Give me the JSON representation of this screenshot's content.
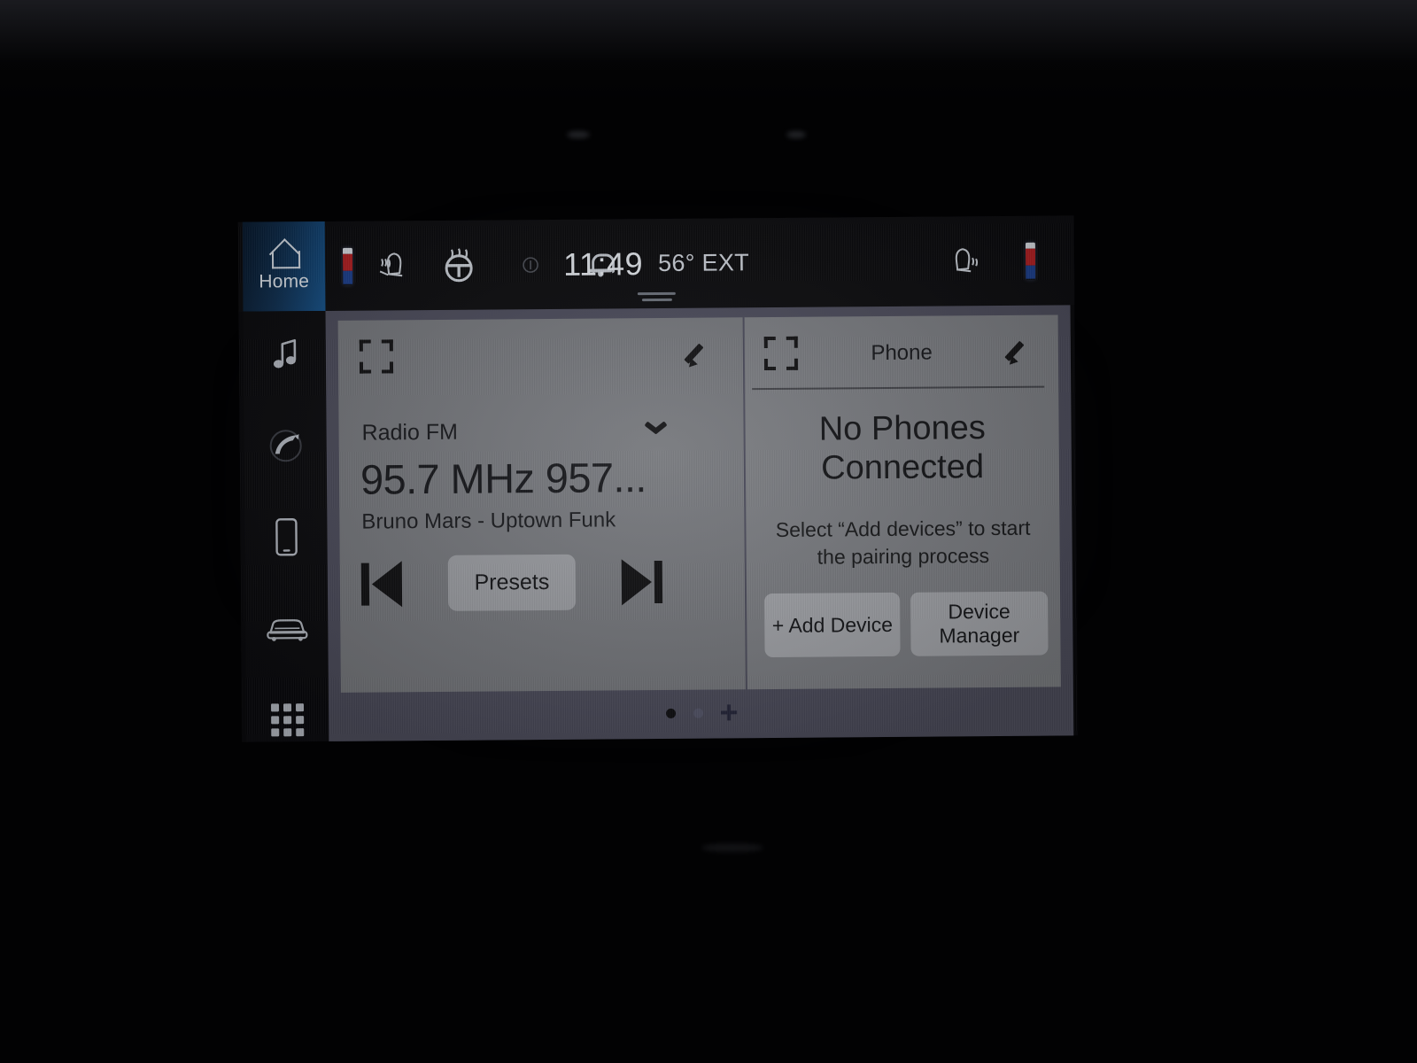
{
  "statusbar": {
    "home_label": "Home",
    "clock": "11:49",
    "exterior_temp": "56° EXT",
    "icons": {
      "home": "home-icon",
      "driver_temp_bar": "driver-temperature-bar",
      "driver_seat_heater": "driver-seat-heater-icon",
      "steering_wheel_heater": "steering-wheel-heater-icon",
      "recirculation": "recirculation-icon",
      "notification_bell": "bell-icon",
      "passenger_seat_heater": "passenger-seat-heater-icon",
      "passenger_temp_bar": "passenger-temperature-bar"
    }
  },
  "sidebar": {
    "items": [
      {
        "name": "audio",
        "icon": "music-note-icon"
      },
      {
        "name": "phone",
        "icon": "phone-handset-icon"
      },
      {
        "name": "devices",
        "icon": "smartphone-icon"
      },
      {
        "name": "vehicle",
        "icon": "car-front-icon"
      },
      {
        "name": "apps",
        "icon": "apps-grid-icon"
      }
    ]
  },
  "media_card": {
    "expand_icon": "expand-icon",
    "edit_icon": "pencil-edit-icon",
    "source": "Radio FM",
    "source_chevron": "chevron-down-icon",
    "station": "95.7 MHz 957...",
    "track": "Bruno Mars - Uptown Funk",
    "prev_icon": "previous-track-icon",
    "next_icon": "next-track-icon",
    "presets_label": "Presets"
  },
  "phone_card": {
    "expand_icon": "expand-icon",
    "title": "Phone",
    "edit_icon": "pencil-edit-icon",
    "status_line1": "No Phones",
    "status_line2": "Connected",
    "instruction_line1": "Select “Add devices” to start",
    "instruction_line2": "the pairing process",
    "add_device_label": "+ Add Device",
    "device_manager_line1": "Device",
    "device_manager_line2": "Manager"
  },
  "pager": {
    "pages": 2,
    "active_page": 1,
    "add_page_icon": "plus-icon"
  },
  "colors": {
    "screen_background": "#4b4b5b",
    "card": "#76787d",
    "card_alt": "#7b7d82",
    "button": "#a3a5aa",
    "home_accent": "#14528c",
    "status_bar": "#09090c"
  }
}
